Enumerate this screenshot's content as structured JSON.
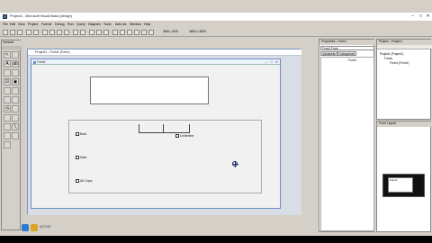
{
  "window": {
    "title": "Project1 - Microsoft Visual Basic [design]",
    "minimize": "–",
    "maximize": "□",
    "close": "✕"
  },
  "menu": [
    "File",
    "Edit",
    "View",
    "Project",
    "Format",
    "Debug",
    "Run",
    "Query",
    "Diagram",
    "Tools",
    "Add-Ins",
    "Window",
    "Help"
  ],
  "toolbar": {
    "position": "3840, 1620",
    "size": "4800 x 3600"
  },
  "toolbox": {
    "title": "General"
  },
  "project_window": {
    "title": "Project1 - Form1 (Form)"
  },
  "form": {
    "title": "Form1",
    "checkboxes": [
      "Bold",
      "Italic",
      "All Caps"
    ],
    "underline_label": "Underline"
  },
  "properties": {
    "title": "Properties - Form1",
    "object": "Form1 Form",
    "tabs": [
      "Alphabetic",
      "Categorized"
    ],
    "first_row": "Form1"
  },
  "project_explorer": {
    "title": "Project - Project1",
    "nodes": [
      "Project1 (Project1)",
      "Forms",
      "Form1 (Form1)"
    ]
  },
  "form_layout": {
    "title": "Form Layout",
    "preview_label": "Form1"
  },
  "taskbar": {
    "label": "ACTIVE"
  }
}
